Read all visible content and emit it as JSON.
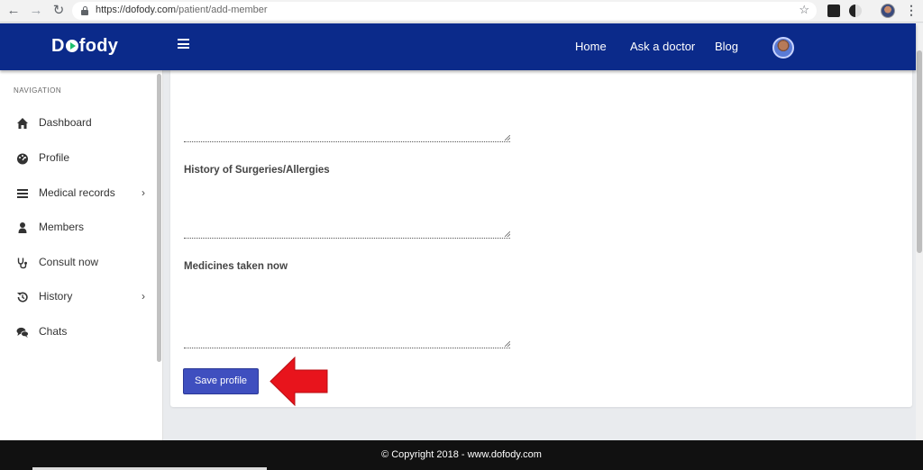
{
  "browser": {
    "url_host": "https://dofody.com",
    "url_path": "/patient/add-member"
  },
  "header": {
    "brand_pre": "D",
    "brand_post": "fody",
    "nav": [
      "Home",
      "Ask a doctor",
      "Blog"
    ]
  },
  "sidebar": {
    "heading": "NAVIGATION",
    "items": [
      {
        "label": "Dashboard",
        "icon": "home-icon",
        "has_submenu": false
      },
      {
        "label": "Profile",
        "icon": "dashboard-gauge-icon",
        "has_submenu": false
      },
      {
        "label": "Medical records",
        "icon": "list-icon",
        "has_submenu": true
      },
      {
        "label": "Members",
        "icon": "user-icon",
        "has_submenu": false
      },
      {
        "label": "Consult now",
        "icon": "stethoscope-icon",
        "has_submenu": false
      },
      {
        "label": "History",
        "icon": "history-icon",
        "has_submenu": true
      },
      {
        "label": "Chats",
        "icon": "chat-bubbles-icon",
        "has_submenu": false
      }
    ],
    "chevron": "›"
  },
  "form": {
    "surgeries_label": "History of Surgeries/Allergies",
    "medicines_label": "Medicines taken now",
    "save_label": "Save profile"
  },
  "footer": {
    "copyright": "© Copyright 2018 - www.dofody.com"
  },
  "colors": {
    "header_bg": "#0b2a8a",
    "button_bg": "#3f4fbf",
    "arrow": "#e8141c",
    "footer_bg": "#111111"
  }
}
